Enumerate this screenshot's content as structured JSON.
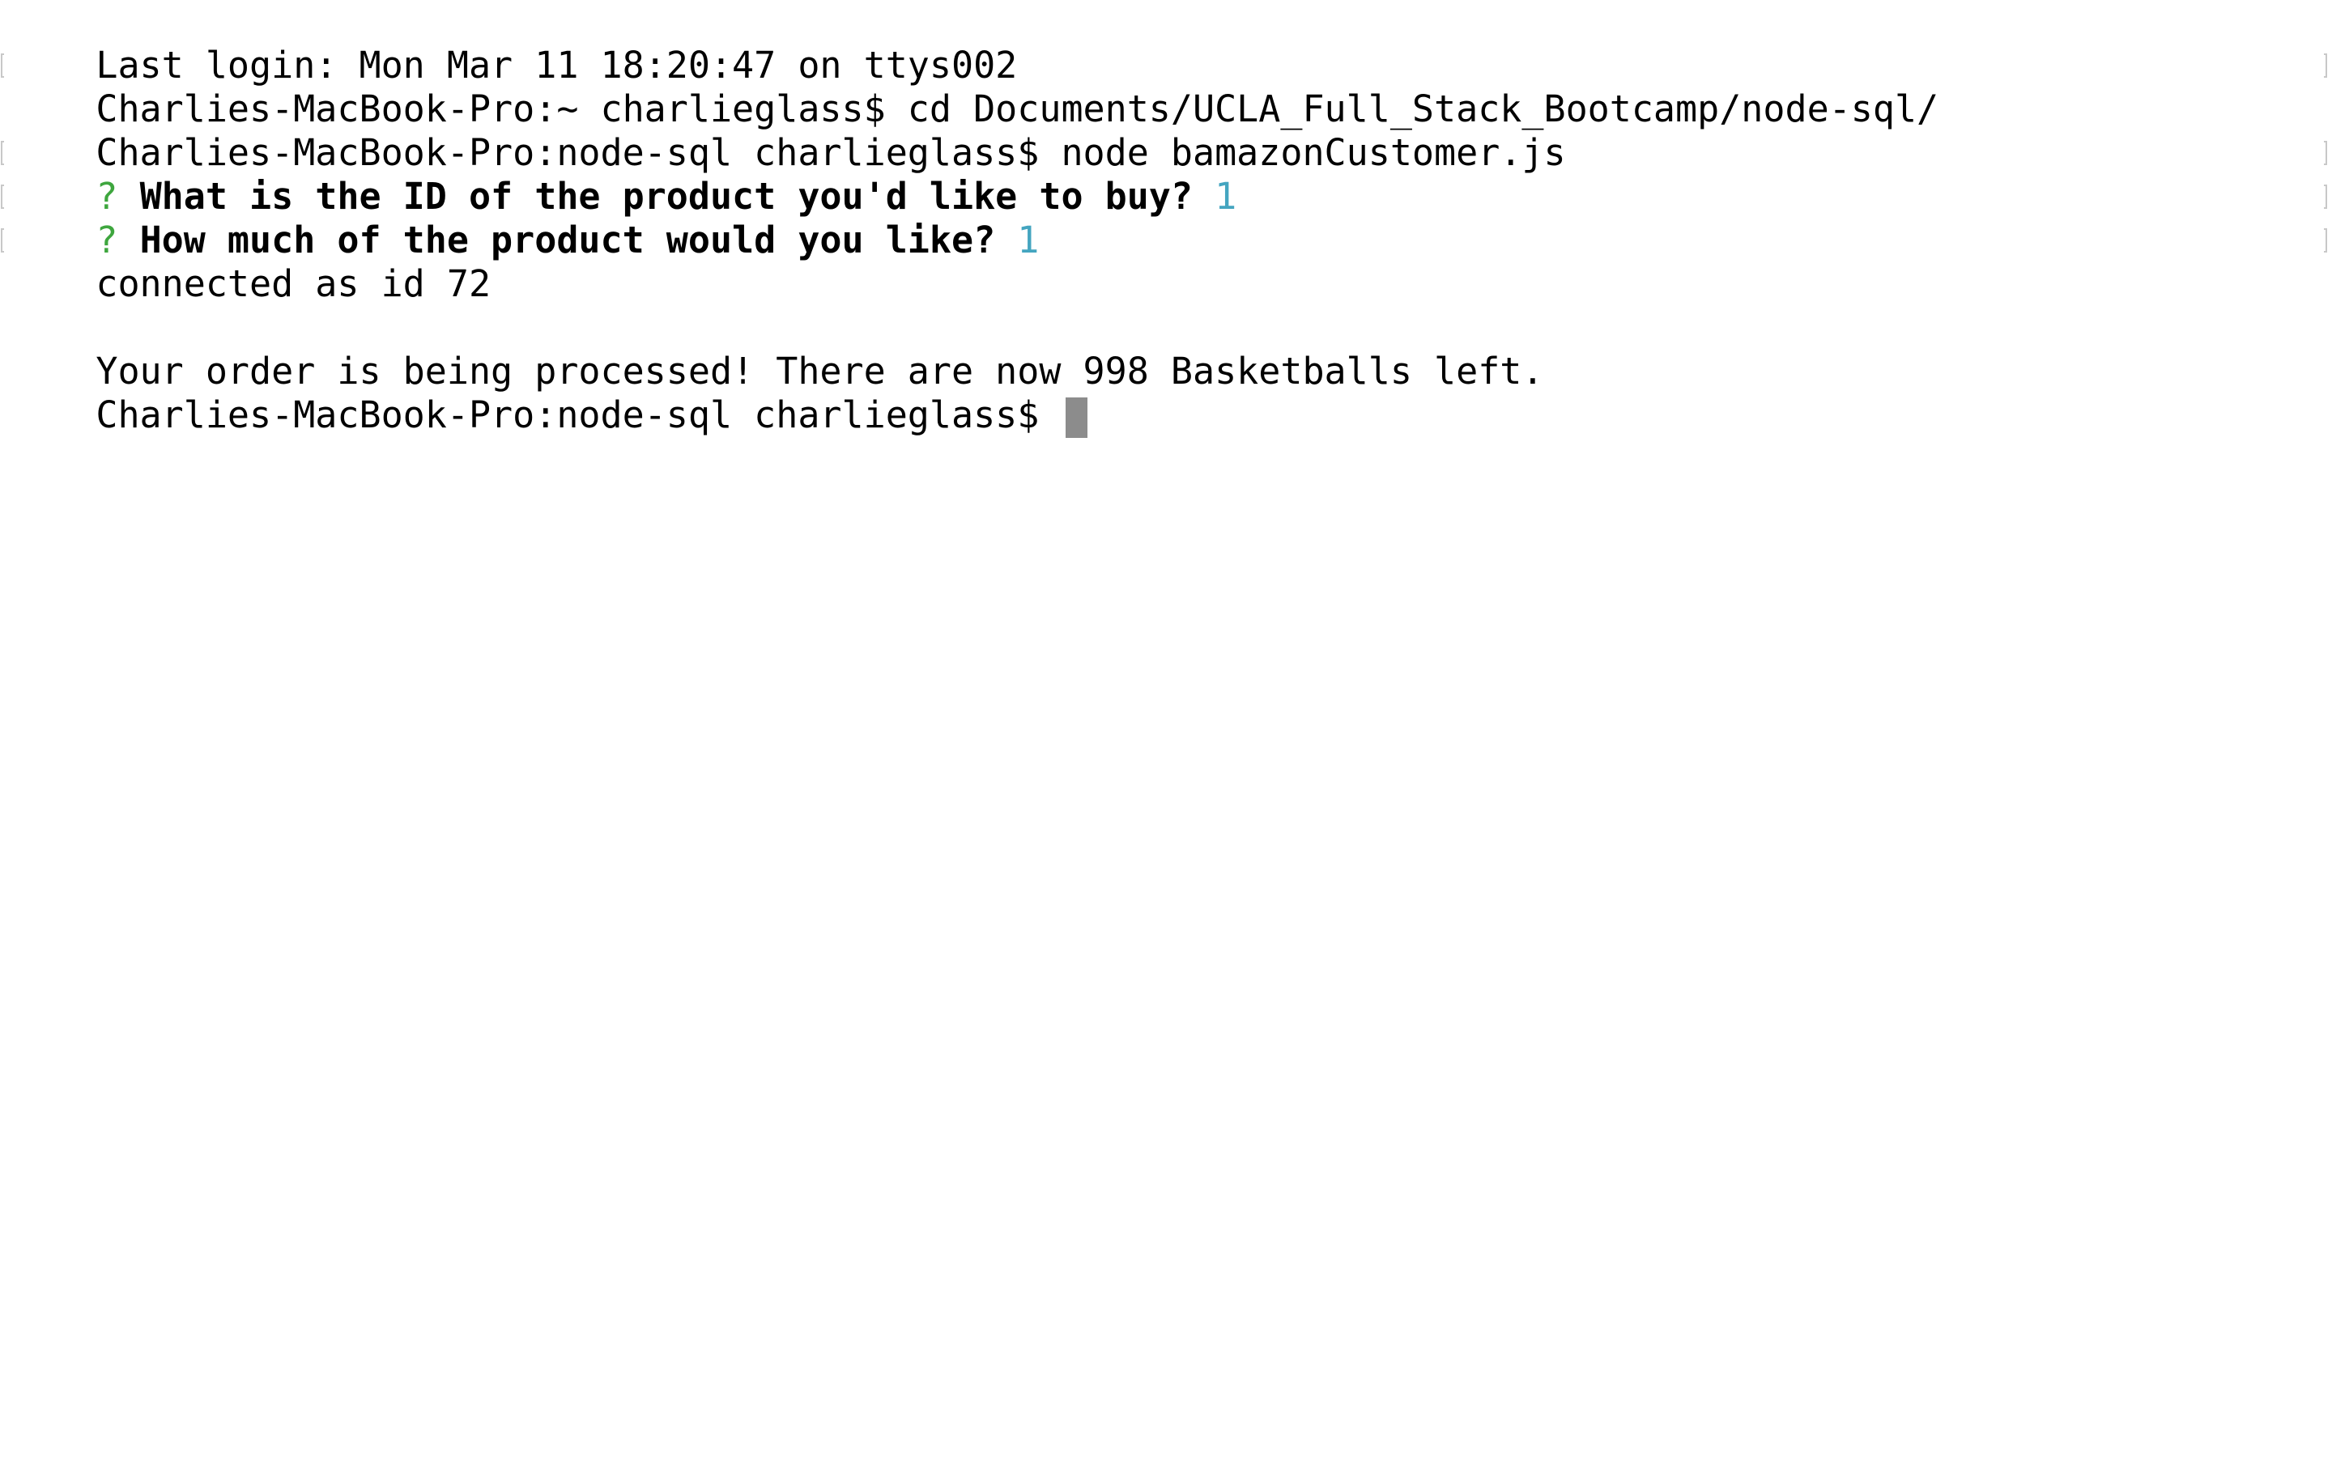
{
  "terminal": {
    "last_login": "Last login: Mon Mar 11 18:20:47 on ttys002",
    "cmd1_prompt": "Charlies-MacBook-Pro:~ charlieglass$ ",
    "cmd1_command": "cd Documents/UCLA_Full_Stack_Bootcamp/node-sql/",
    "cmd2_prompt": "Charlies-MacBook-Pro:node-sql charlieglass$ ",
    "cmd2_command": "node bamazonCustomer.js",
    "q1_marker": "?",
    "q1_text": "What is the ID of the product you'd like to buy?",
    "q1_answer": "1",
    "q2_marker": "?",
    "q2_text": "How much of the product would you like?",
    "q2_answer": "1",
    "connected": "connected as id 72",
    "order_message": "Your order is being processed! There are now 998 Basketballs left.",
    "final_prompt": "Charlies-MacBook-Pro:node-sql charlieglass$ "
  },
  "colors": {
    "background": "#ffffff",
    "text": "#000000",
    "question_marker": "#3ea63e",
    "answer": "#44a5c0",
    "cursor": "#8c8c8c"
  }
}
